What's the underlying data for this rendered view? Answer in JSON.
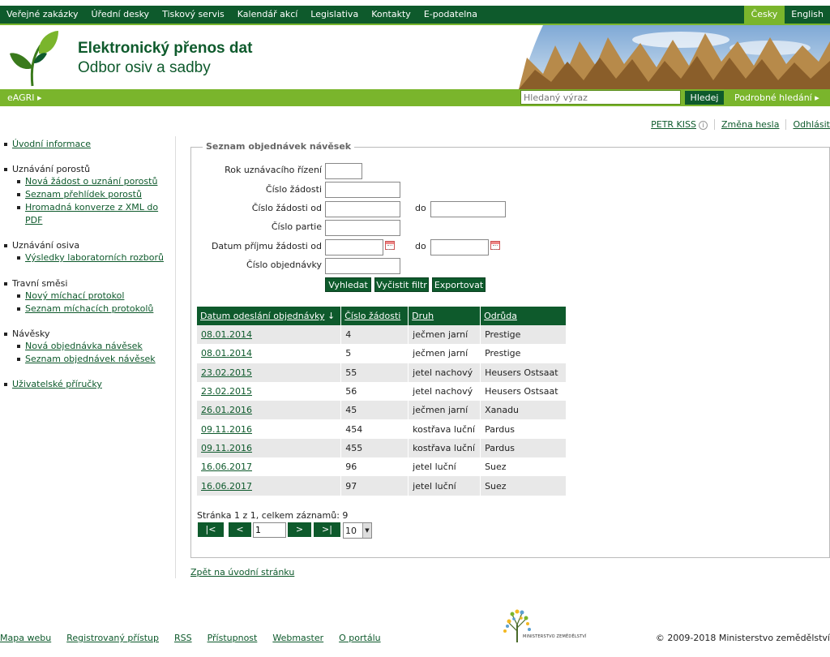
{
  "topnav": {
    "items": [
      "Veřejné zakázky",
      "Úřední desky",
      "Tiskový servis",
      "Kalendář akcí",
      "Legislativa",
      "Kontakty",
      "E-podatelna"
    ],
    "lang_active": "Česky",
    "lang_other": "English"
  },
  "header": {
    "title": "Elektronický přenos dat",
    "subtitle": "Odbor osiv a sadby"
  },
  "searchbar": {
    "eagri": "eAGRI",
    "placeholder": "Hledaný výraz",
    "button": "Hledej",
    "advanced": "Podrobné hledání"
  },
  "user": {
    "name": "PETR KISS",
    "change_password": "Změna hesla",
    "logout": "Odhlásit"
  },
  "sidebar": {
    "intro": "Úvodní informace",
    "s1": {
      "title": "Uznávání porostů",
      "items": [
        "Nová žádost o uznání porostů",
        "Seznam přehlídek porostů",
        "Hromadná konverze z XML do",
        "PDF"
      ]
    },
    "s2": {
      "title": "Uznávání osiva",
      "items": [
        "Výsledky laboratorních rozborů"
      ]
    },
    "s3": {
      "title": "Travní směsi",
      "items": [
        "Nový míchací protokol",
        "Seznam míchacích protokolů"
      ]
    },
    "s4": {
      "title": "Návěsky",
      "items": [
        "Nová objednávka návěsek",
        "Seznam objednávek návěsek"
      ]
    },
    "manuals": "Uživatelské příručky"
  },
  "form": {
    "legend": "Seznam objednávek návěsek",
    "labels": {
      "rok": "Rok uznávacího řízení",
      "cislo_zadosti": "Číslo žádosti",
      "cislo_zadosti_od": "Číslo žádosti od",
      "cislo_partie": "Číslo partie",
      "datum_prijmu_od": "Datum příjmu žádosti od",
      "cislo_objednavky": "Číslo objednávky",
      "do": "do"
    },
    "values": {
      "rok": "",
      "cislo_zadosti": "",
      "od": "",
      "do": "",
      "partie": "",
      "datum_od": "",
      "datum_do": "",
      "objednavka": ""
    },
    "buttons": {
      "search": "Vyhledat",
      "clear": "Vyčistit filtr",
      "export": "Exportovat"
    }
  },
  "table": {
    "headers": [
      "Datum odeslání objednávky",
      "Číslo žádosti",
      "Druh",
      "Odrůda"
    ],
    "sort_indicator": "↓",
    "rows": [
      [
        "08.01.2014",
        "4",
        "ječmen jarní",
        "Prestige"
      ],
      [
        "08.01.2014",
        "5",
        "ječmen jarní",
        "Prestige"
      ],
      [
        "23.02.2015",
        "55",
        "jetel nachový",
        "Heusers Ostsaat"
      ],
      [
        "23.02.2015",
        "56",
        "jetel nachový",
        "Heusers Ostsaat"
      ],
      [
        "26.01.2016",
        "45",
        "ječmen jarní",
        "Xanadu"
      ],
      [
        "09.11.2016",
        "454",
        "kostřava luční",
        "Pardus"
      ],
      [
        "09.11.2016",
        "455",
        "kostřava luční",
        "Pardus"
      ],
      [
        "16.06.2017",
        "96",
        "jetel luční",
        "Suez"
      ],
      [
        "16.06.2017",
        "97",
        "jetel luční",
        "Suez"
      ]
    ]
  },
  "pager": {
    "info": "Stránka 1 z 1, celkem záznamů: 9",
    "first": "|<",
    "prev": "<",
    "page": "1",
    "next": ">",
    "last": ">|",
    "page_size": "10"
  },
  "back_link": "Zpět na úvodní stránku",
  "footer": {
    "links": [
      "Mapa webu",
      "Registrovaný přístup",
      "RSS",
      "Přístupnost",
      "Webmaster",
      "O portálu"
    ],
    "ministry": "MINISTERSTVO ZEMĚDĚLSTVÍ",
    "copyright": "© 2009-2018 Ministerstvo zemědělství"
  },
  "colors": {
    "dark_green": "#0e5a2c",
    "light_green": "#7ab52c",
    "row_alt": "#e8e8e8"
  }
}
